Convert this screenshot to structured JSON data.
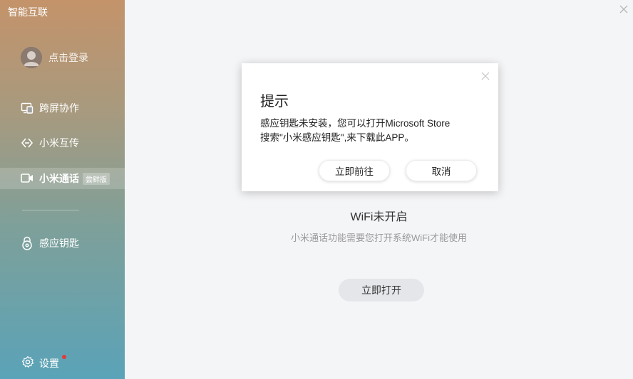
{
  "app": {
    "title": "智能互联"
  },
  "sidebar": {
    "user": {
      "login_label": "点击登录",
      "avatar_icon": "user-avatar-icon"
    },
    "items": [
      {
        "label": "跨屏协作",
        "icon": "screen-share-icon",
        "active": false
      },
      {
        "label": "小米互传",
        "icon": "transfer-icon",
        "active": false
      },
      {
        "label": "小米通话",
        "icon": "video-call-icon",
        "active": true,
        "badge": "尝鲜版"
      },
      {
        "label": "感应钥匙",
        "icon": "lock-icon",
        "active": false
      }
    ],
    "settings": {
      "label": "设置",
      "icon": "gear-icon",
      "has_notification": true
    }
  },
  "main": {
    "status_title": "WiFi未开启",
    "status_description": "小米通话功能需要您打开系统WiFi才能使用",
    "open_button": "立即打开"
  },
  "dialog": {
    "title": "提示",
    "message_line1": "感应钥匙未安装，您可以打开Microsoft Store",
    "message_line2": "搜索\"小米感应钥匙\",来下载此APP。",
    "confirm_button": "立即前往",
    "cancel_button": "取消"
  },
  "colors": {
    "sidebar_top": "#c4936a",
    "sidebar_bottom": "#5aa3b8",
    "notification_dot": "#e23b3b",
    "main_background": "#f4f5f7"
  }
}
